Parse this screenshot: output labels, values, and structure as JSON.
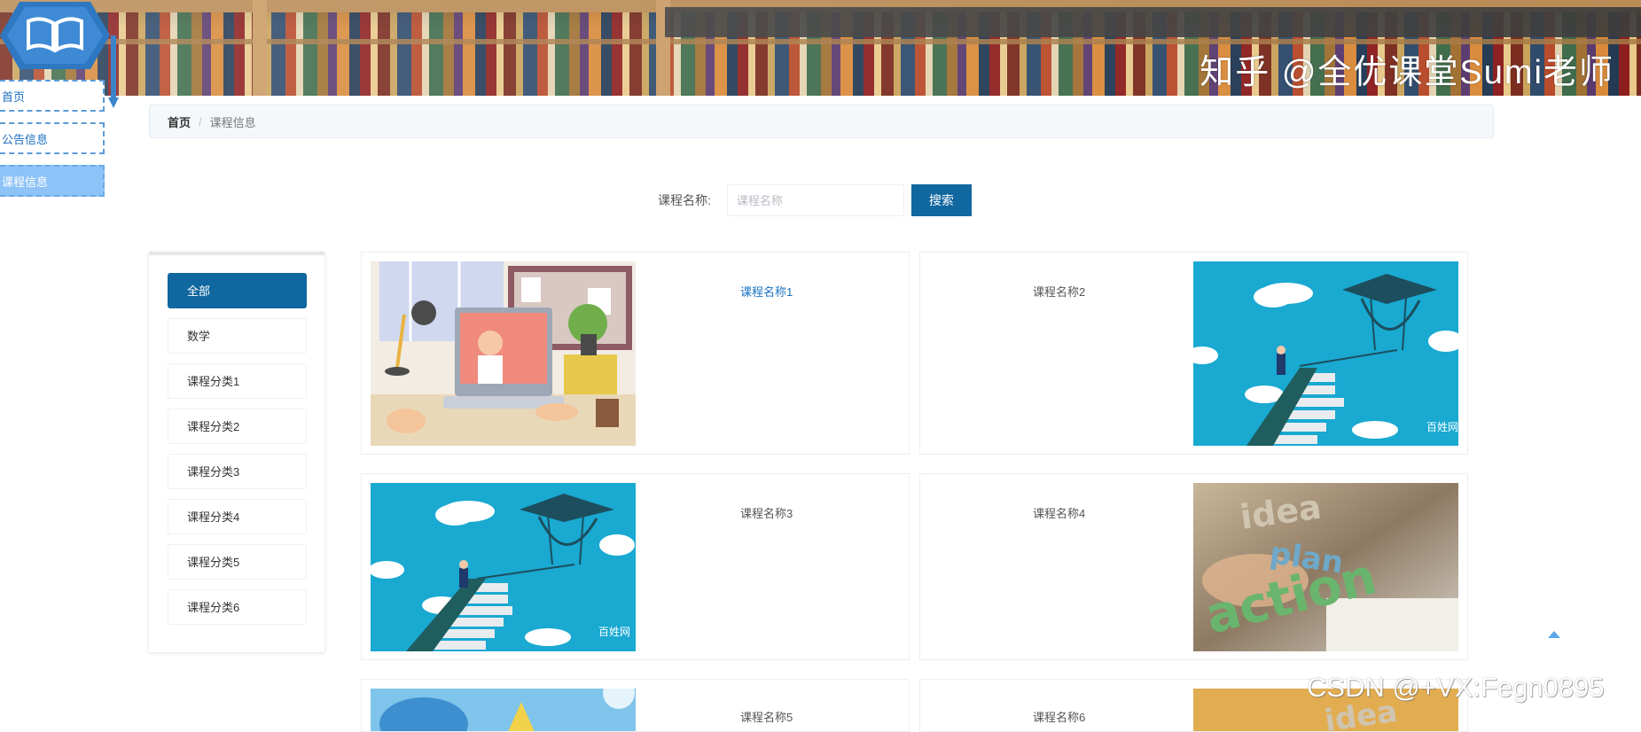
{
  "banner": {
    "watermark": "知乎 @全优课堂Sumi老师"
  },
  "side_nav": {
    "items": [
      {
        "label": "首页"
      },
      {
        "label": "公告信息"
      },
      {
        "label": "课程信息"
      }
    ],
    "active_index": 2
  },
  "breadcrumb": {
    "home": "首页",
    "separator": "/",
    "current": "课程信息"
  },
  "search": {
    "label": "课程名称:",
    "placeholder": "课程名称",
    "value": "",
    "button": "搜索"
  },
  "categories": {
    "items": [
      {
        "label": "全部"
      },
      {
        "label": "数学"
      },
      {
        "label": "课程分类1"
      },
      {
        "label": "课程分类2"
      },
      {
        "label": "课程分类3"
      },
      {
        "label": "课程分类4"
      },
      {
        "label": "课程分类5"
      },
      {
        "label": "课程分类6"
      }
    ],
    "active_index": 0
  },
  "courses": {
    "items": [
      {
        "title": "课程名称1",
        "image": "online-class-illustration"
      },
      {
        "title": "课程名称2",
        "image": "graduation-stairs-illustration"
      },
      {
        "title": "课程名称3",
        "image": "graduation-stairs-illustration"
      },
      {
        "title": "课程名称4",
        "image": "idea-plan-action-photo"
      },
      {
        "title": "课程名称5",
        "image": "blue-abstract-illustration"
      },
      {
        "title": "课程名称6",
        "image": "idea-plan-action-photo"
      }
    ]
  },
  "image_text": {
    "stairs_brand": "百姓网",
    "idea_words": [
      "idea",
      "plan",
      "action"
    ]
  },
  "footer": {
    "watermark": "CSDN @+VX:Fegn0895"
  },
  "colors": {
    "primary": "#11679f",
    "side_nav_active": "#8ec3f7",
    "link": "#1a73c2",
    "breadcrumb_bg": "#f4f8fb"
  },
  "icons": {
    "logo": "open-book-icon",
    "back_to_top": "caret-up-icon"
  }
}
